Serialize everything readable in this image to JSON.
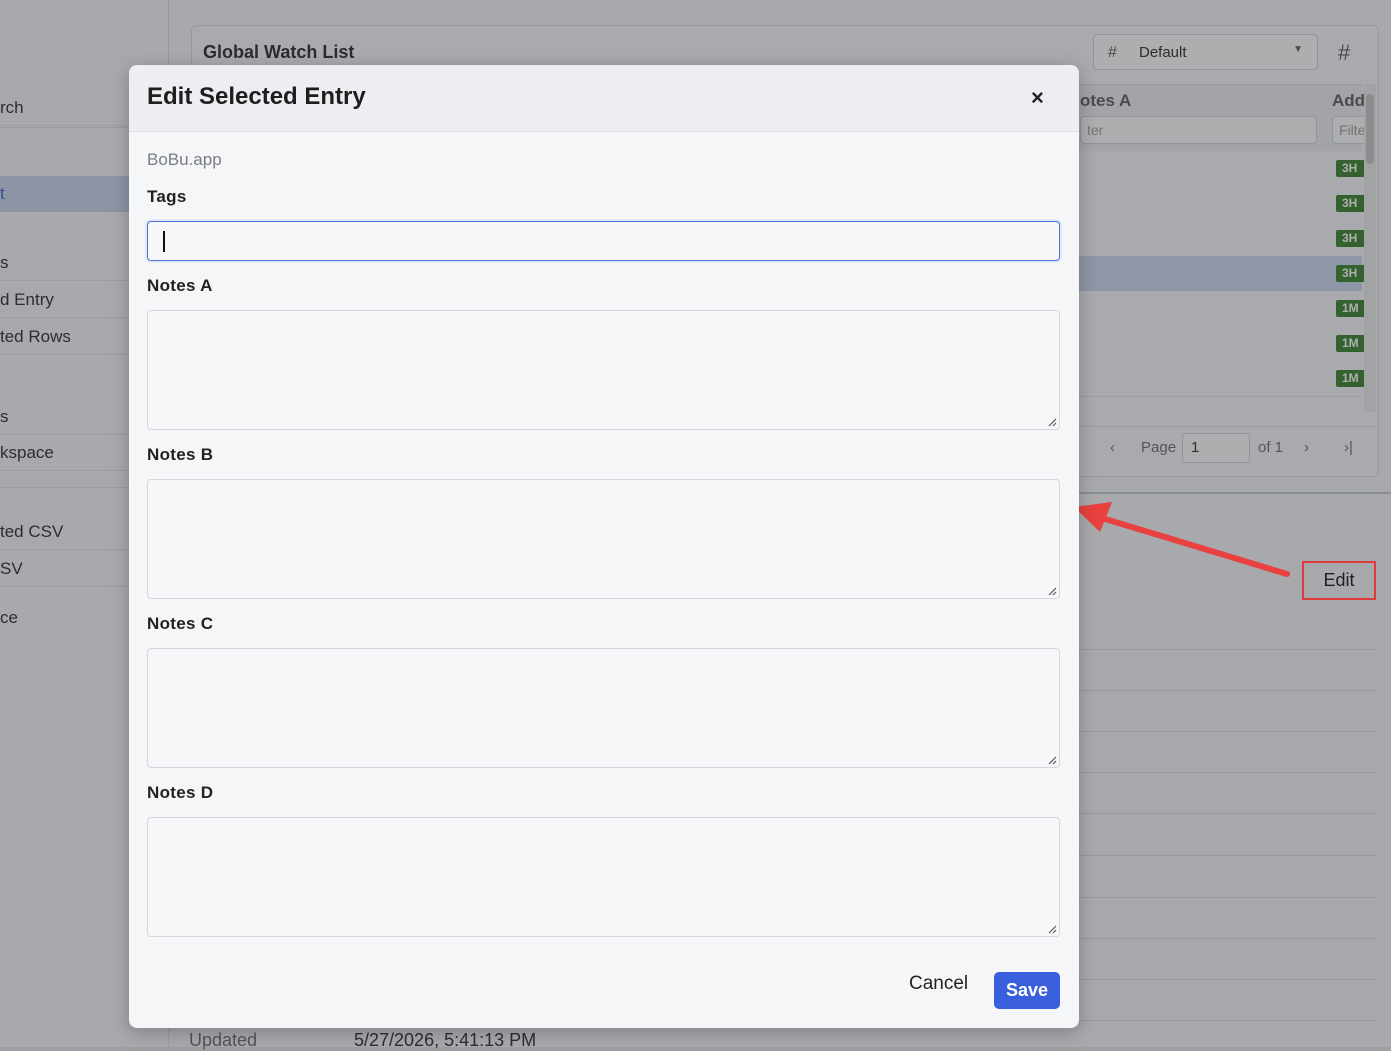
{
  "sidebar": {
    "items": [
      "rch",
      "t",
      "s",
      "d Entry",
      "ted Rows",
      "s",
      "kspace",
      "ted CSV",
      "SV",
      "ce"
    ]
  },
  "panel": {
    "title": "Global Watch List",
    "layout_value": "Default",
    "column_notes_a": "otes A",
    "column_add": "Add",
    "filter_notes_a": "ter",
    "filter_add": "Filte",
    "badges": [
      "3H",
      "3H",
      "3H",
      "3H",
      "1M",
      "1M",
      "1M"
    ],
    "pager": {
      "page_label": "Page",
      "page_value": "1",
      "of_label": "of 1"
    }
  },
  "details": {
    "edit_label": "Edit",
    "updated_label": "Updated",
    "updated_value": "5/27/2026, 5:41:13 PM"
  },
  "modal": {
    "title": "Edit Selected Entry",
    "close_label": "×",
    "subtitle": "BoBu.app",
    "tags_label": "Tags",
    "tags_value": "",
    "notes_a_label": "Notes A",
    "notes_b_label": "Notes B",
    "notes_c_label": "Notes C",
    "notes_d_label": "Notes D",
    "cancel_label": "Cancel",
    "save_label": "Save"
  },
  "colors": {
    "accent": "#3a5fdc",
    "annotation": "#e03b3b",
    "badge": "#2e7d1f",
    "selected_row": "#cbd6ef"
  }
}
